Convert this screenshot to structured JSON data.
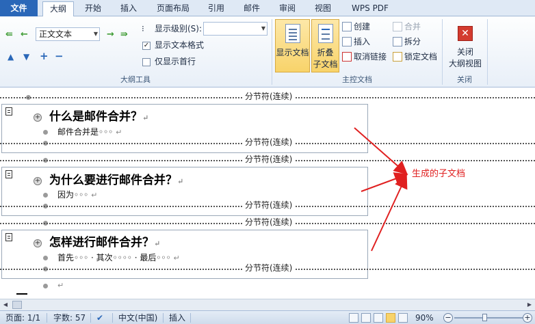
{
  "tabs": [
    {
      "label": "文件"
    },
    {
      "label": "大纲"
    },
    {
      "label": "开始"
    },
    {
      "label": "插入"
    },
    {
      "label": "页面布局"
    },
    {
      "label": "引用"
    },
    {
      "label": "邮件"
    },
    {
      "label": "审阅"
    },
    {
      "label": "视图"
    },
    {
      "label": "WPS PDF"
    }
  ],
  "outline_tools": {
    "level_combo_value": "正文文本",
    "show_level_label": "显示级别(S):",
    "show_level_value": "",
    "show_text_format_label": "显示文本格式",
    "show_text_format_checked": true,
    "show_first_line_label": "仅显示首行",
    "show_first_line_checked": false,
    "group_label": "大纲工具"
  },
  "master_doc": {
    "show_doc_label": "显示文档",
    "collapse_label_1": "折叠",
    "collapse_label_2": "子文档",
    "create_label": "创建",
    "insert_label": "插入",
    "unlink_label": "取消链接",
    "merge_label": "合并",
    "split_label": "拆分",
    "lock_label": "锁定文档",
    "group_label": "主控文档"
  },
  "close_group": {
    "close_label_1": "关闭",
    "close_label_2": "大纲视图",
    "group_label": "关闭"
  },
  "document": {
    "section_break_label": "分节符(连续)",
    "subdocs": [
      {
        "heading": "什么是邮件合并？",
        "body": "邮件合并是◦◦◦"
      },
      {
        "heading": "为什么要进行邮件合并？",
        "body": "因为◦◦◦"
      },
      {
        "heading": "怎样进行邮件合并？",
        "body": "首先◦◦◦ · 其次◦◦◦◦ · 最后◦◦◦"
      }
    ],
    "para_mark": "↵",
    "callout": "生成的子文档",
    "callout_color": "#e02020"
  },
  "status": {
    "page": "页面: 1/1",
    "words": "字数: 57",
    "language": "中文(中国)",
    "mode": "插入",
    "zoom": "90%"
  }
}
